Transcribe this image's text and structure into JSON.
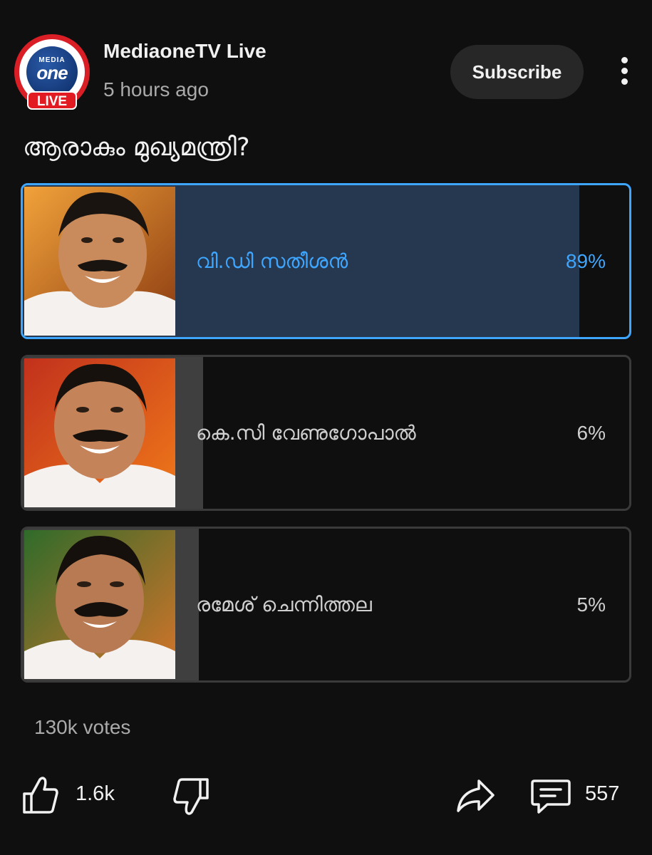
{
  "channel": {
    "name": "MediaoneTV Live",
    "time": "5 hours ago",
    "avatar": {
      "media_text": "MEDIA",
      "one_text": "one",
      "live_badge": "LIVE"
    },
    "subscribe_label": "Subscribe"
  },
  "poll": {
    "question": "ആരാകും മുഖ്യമന്ത്രി?",
    "options": [
      {
        "label": "വി.ഡി സതീശൻ",
        "percent_text": "89%",
        "percent": 89,
        "selected": true,
        "photo": "candidate-1-photo"
      },
      {
        "label": "കെ.സി വേണുഗോപാൽ",
        "percent_text": "6%",
        "percent": 6,
        "selected": false,
        "photo": "candidate-2-photo"
      },
      {
        "label": "രമേശ് ചെന്നിത്തല",
        "percent_text": "5%",
        "percent": 5,
        "selected": false,
        "photo": "candidate-3-photo"
      }
    ],
    "votes": "130k votes"
  },
  "actions": {
    "like_count": "1.6k",
    "comment_count": "557",
    "icons": [
      "thumbs-up-icon",
      "thumbs-down-icon",
      "share-icon",
      "comment-icon"
    ]
  },
  "colors": {
    "background": "#0f0f0f",
    "accent": "#3ea6ff",
    "selected_fill": "#263850",
    "unselected_fill": "#3f3f3f",
    "brand_red": "#e21b23"
  }
}
